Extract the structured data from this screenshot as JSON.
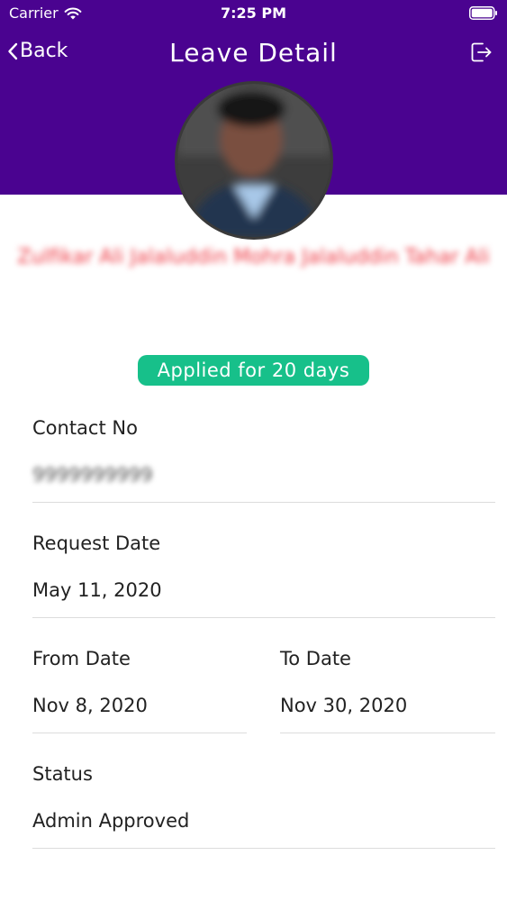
{
  "status_bar": {
    "carrier": "Carrier",
    "time": "7:25 PM"
  },
  "nav": {
    "back_label": "Back",
    "title": "Leave Detail"
  },
  "employee": {
    "name": "Zulfikar Ali Jalaluddin Mohra Jalaluddin Tahar Ali"
  },
  "badge": {
    "text": "Applied for 20 days",
    "color": "#17c08a"
  },
  "fields": {
    "contact": {
      "label": "Contact No",
      "value": "9999999999"
    },
    "request_date": {
      "label": "Request Date",
      "value": "May 11, 2020"
    },
    "from_date": {
      "label": "From Date",
      "value": "Nov 8, 2020"
    },
    "to_date": {
      "label": "To Date",
      "value": "Nov 30, 2020"
    },
    "status": {
      "label": "Status",
      "value": "Admin Approved"
    }
  },
  "colors": {
    "header": "#4a0390",
    "name": "#ee3a44"
  },
  "icons": {
    "wifi": "wifi-icon",
    "battery": "battery-icon",
    "back": "chevron-left-icon",
    "logout": "logout-icon"
  }
}
